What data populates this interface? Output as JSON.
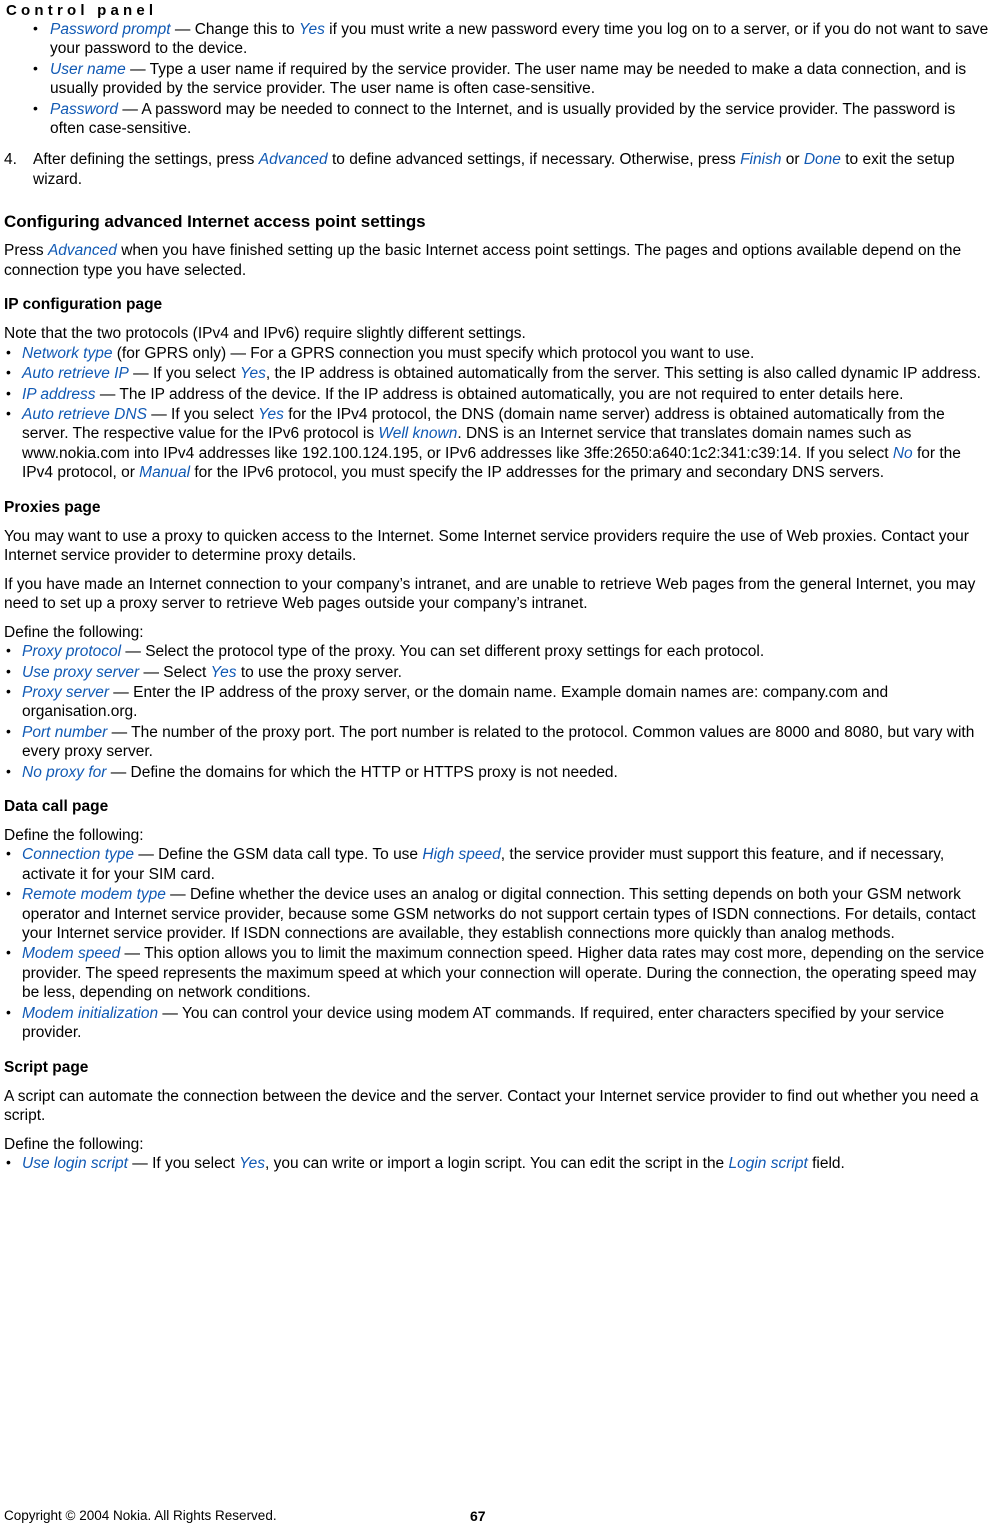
{
  "header": {
    "running_title": "Control panel"
  },
  "intro_bullets": [
    {
      "term": "Password prompt",
      "parts": [
        {
          "t": "text",
          "v": " — Change this to "
        },
        {
          "t": "ui",
          "v": "Yes"
        },
        {
          "t": "text",
          "v": " if you must write a new password every time you log on to a server, or if you do not want to save your password to the device."
        }
      ]
    },
    {
      "term": "User name",
      "parts": [
        {
          "t": "text",
          "v": " — Type a user name if required by the service provider. The user name may be needed to make a data connection, and is usually provided by the service provider. The user name is often case-sensitive."
        }
      ]
    },
    {
      "term": "Password",
      "parts": [
        {
          "t": "text",
          "v": " — A password may be needed to connect to the Internet, and is usually provided by the service provider. The password is often case-sensitive."
        }
      ]
    }
  ],
  "step4": {
    "number": "4.",
    "parts": [
      {
        "t": "text",
        "v": "After defining the settings, press "
      },
      {
        "t": "ui",
        "v": "Advanced"
      },
      {
        "t": "text",
        "v": " to define advanced settings, if necessary. Otherwise, press "
      },
      {
        "t": "ui",
        "v": "Finish"
      },
      {
        "t": "text",
        "v": " or "
      },
      {
        "t": "ui",
        "v": "Done"
      },
      {
        "t": "text",
        "v": " to exit the setup wizard."
      }
    ]
  },
  "section": {
    "title": "Configuring advanced Internet access point settings",
    "intro_parts": [
      {
        "t": "text",
        "v": "Press "
      },
      {
        "t": "ui",
        "v": "Advanced"
      },
      {
        "t": "text",
        "v": " when you have finished setting up the basic Internet access point settings. The pages and options available depend on the connection type you have selected."
      }
    ]
  },
  "ip_page": {
    "heading": "IP configuration page",
    "note": "Note that the two protocols (IPv4 and IPv6) require slightly different settings.",
    "bullets": [
      {
        "term": "Network type",
        "parts": [
          {
            "t": "text",
            "v": " (for GPRS only) — For a GPRS connection you must specify which protocol you want to use."
          }
        ]
      },
      {
        "term": "Auto retrieve IP",
        "parts": [
          {
            "t": "text",
            "v": " — If you select "
          },
          {
            "t": "ui",
            "v": "Yes"
          },
          {
            "t": "text",
            "v": ", the IP address is obtained automatically from the server. This setting is also called dynamic IP address."
          }
        ]
      },
      {
        "term": "IP address",
        "parts": [
          {
            "t": "text",
            "v": " — The IP address of the device. If the IP address is obtained automatically, you are not required to enter details here."
          }
        ]
      },
      {
        "term": "Auto retrieve DNS",
        "parts": [
          {
            "t": "text",
            "v": " — If you select "
          },
          {
            "t": "ui",
            "v": "Yes"
          },
          {
            "t": "text",
            "v": " for the IPv4 protocol, the DNS (domain name server) address is obtained automatically from the server. The respective value for the IPv6 protocol is "
          },
          {
            "t": "ui",
            "v": "Well known"
          },
          {
            "t": "text",
            "v": ". DNS is an Internet service that translates domain names such as www.nokia.com into IPv4 addresses like 192.100.124.195, or IPv6 addresses like 3ffe:2650:a640:1c2:341:c39:14. If you select "
          },
          {
            "t": "ui",
            "v": "No"
          },
          {
            "t": "text",
            "v": " for the IPv4 protocol, or "
          },
          {
            "t": "ui",
            "v": "Manual"
          },
          {
            "t": "text",
            "v": " for the IPv6 protocol, you must specify the IP addresses for the primary and secondary DNS servers."
          }
        ]
      }
    ]
  },
  "proxies_page": {
    "heading": "Proxies page",
    "para1": "You may want to use a proxy to quicken access to the Internet. Some Internet service providers require the use of Web proxies. Contact your Internet service provider to determine proxy details.",
    "para2": "If you have made an Internet connection to your company’s intranet, and are unable to retrieve Web pages from the general Internet, you may need to set up a proxy server to retrieve Web pages outside your company’s intranet.",
    "define_label": "Define the following:",
    "bullets": [
      {
        "term": "Proxy protocol",
        "parts": [
          {
            "t": "text",
            "v": " — Select the protocol type of the proxy. You can set different proxy settings for each protocol."
          }
        ]
      },
      {
        "term": "Use proxy server",
        "parts": [
          {
            "t": "text",
            "v": " — Select "
          },
          {
            "t": "ui",
            "v": "Yes"
          },
          {
            "t": "text",
            "v": " to use the proxy server."
          }
        ]
      },
      {
        "term": "Proxy server",
        "parts": [
          {
            "t": "text",
            "v": " — Enter the IP address of the proxy server, or the domain name. Example domain names are: company.com and organisation.org."
          }
        ]
      },
      {
        "term": "Port number",
        "parts": [
          {
            "t": "text",
            "v": " — The number of the proxy port. The port number is related to the protocol. Common values are 8000 and 8080, but vary with every proxy server."
          }
        ]
      },
      {
        "term": "No proxy for",
        "parts": [
          {
            "t": "text",
            "v": " — Define the domains for which the HTTP or HTTPS proxy is not needed."
          }
        ]
      }
    ]
  },
  "data_call_page": {
    "heading": "Data call page",
    "define_label": "Define the following:",
    "bullets": [
      {
        "term": "Connection type",
        "parts": [
          {
            "t": "text",
            "v": " — Define the GSM data call type. To use "
          },
          {
            "t": "ui",
            "v": "High speed"
          },
          {
            "t": "text",
            "v": ", the service provider must support this feature, and if necessary, activate it for your SIM card."
          }
        ]
      },
      {
        "term": "Remote modem type",
        "parts": [
          {
            "t": "text",
            "v": " — Define whether the device uses an analog or digital connection. This setting depends on both your GSM network operator and Internet service provider, because some GSM networks do not support certain types of ISDN connections. For details, contact your Internet service provider. If ISDN connections are available, they establish connections more quickly than analog methods."
          }
        ]
      },
      {
        "term": "Modem speed",
        "parts": [
          {
            "t": "text",
            "v": " — This option allows you to limit the maximum connection speed. Higher data rates may cost more, depending on the service provider. The speed represents the maximum speed at which your connection will operate. During the connection, the operating speed may be less, depending on network conditions."
          }
        ]
      },
      {
        "term": "Modem initialization",
        "parts": [
          {
            "t": "text",
            "v": " — You can control your device using modem AT commands. If required, enter characters specified by your service provider."
          }
        ]
      }
    ]
  },
  "script_page": {
    "heading": "Script page",
    "para1": "A script can automate the connection between the device and the server. Contact your Internet service provider to find out whether you need a script.",
    "define_label": "Define the following:",
    "bullets": [
      {
        "term": "Use login script",
        "parts": [
          {
            "t": "text",
            "v": " — If you select "
          },
          {
            "t": "ui",
            "v": "Yes"
          },
          {
            "t": "text",
            "v": ", you can write or import a login script. You can edit the script in the "
          },
          {
            "t": "ui",
            "v": "Login script"
          },
          {
            "t": "text",
            "v": " field."
          }
        ]
      }
    ]
  },
  "footer": {
    "copyright": "Copyright © 2004 Nokia. All Rights Reserved.",
    "page_number": "67"
  },
  "colors": {
    "ui_term": "#1059b4",
    "body_text": "#000000",
    "page_background": "#ffffff"
  }
}
